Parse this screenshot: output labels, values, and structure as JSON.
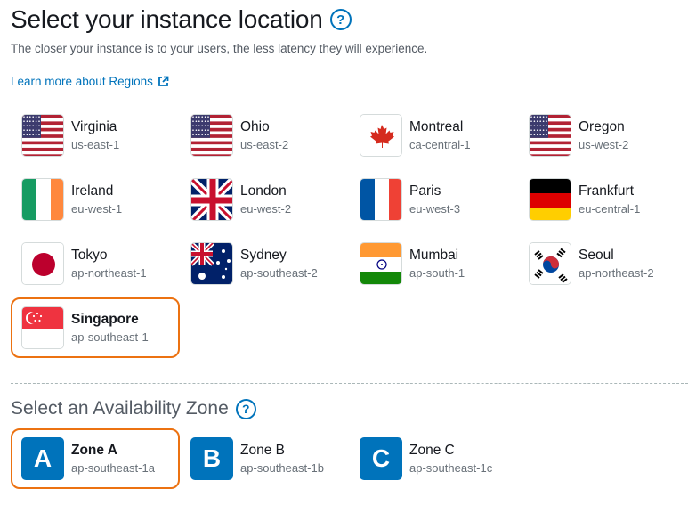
{
  "page": {
    "title": "Select your instance location",
    "subtitle": "The closer your instance is to your users, the less latency they will experience.",
    "learn_more": "Learn more about Regions",
    "help_glyph": "?"
  },
  "regions": [
    {
      "name": "Virginia",
      "code": "us-east-1",
      "flag": "us-flag-icon"
    },
    {
      "name": "Ohio",
      "code": "us-east-2",
      "flag": "us-flag-icon"
    },
    {
      "name": "Montreal",
      "code": "ca-central-1",
      "flag": "canada-flag-icon"
    },
    {
      "name": "Oregon",
      "code": "us-west-2",
      "flag": "us-flag-icon"
    },
    {
      "name": "Ireland",
      "code": "eu-west-1",
      "flag": "ireland-flag-icon"
    },
    {
      "name": "London",
      "code": "eu-west-2",
      "flag": "uk-flag-icon"
    },
    {
      "name": "Paris",
      "code": "eu-west-3",
      "flag": "france-flag-icon"
    },
    {
      "name": "Frankfurt",
      "code": "eu-central-1",
      "flag": "germany-flag-icon"
    },
    {
      "name": "Tokyo",
      "code": "ap-northeast-1",
      "flag": "japan-flag-icon"
    },
    {
      "name": "Sydney",
      "code": "ap-southeast-2",
      "flag": "australia-flag-icon"
    },
    {
      "name": "Mumbai",
      "code": "ap-south-1",
      "flag": "india-flag-icon"
    },
    {
      "name": "Seoul",
      "code": "ap-northeast-2",
      "flag": "korea-flag-icon"
    },
    {
      "name": "Singapore",
      "code": "ap-southeast-1",
      "flag": "singapore-flag-icon",
      "selected": true
    }
  ],
  "availability": {
    "title": "Select an Availability Zone",
    "zones": [
      {
        "letter": "A",
        "name": "Zone A",
        "code": "ap-southeast-1a",
        "selected": true
      },
      {
        "letter": "B",
        "name": "Zone B",
        "code": "ap-southeast-1b"
      },
      {
        "letter": "C",
        "name": "Zone C",
        "code": "ap-southeast-1c"
      }
    ]
  },
  "colors": {
    "accent": "#0073bb",
    "selected_border": "#ec7211"
  }
}
